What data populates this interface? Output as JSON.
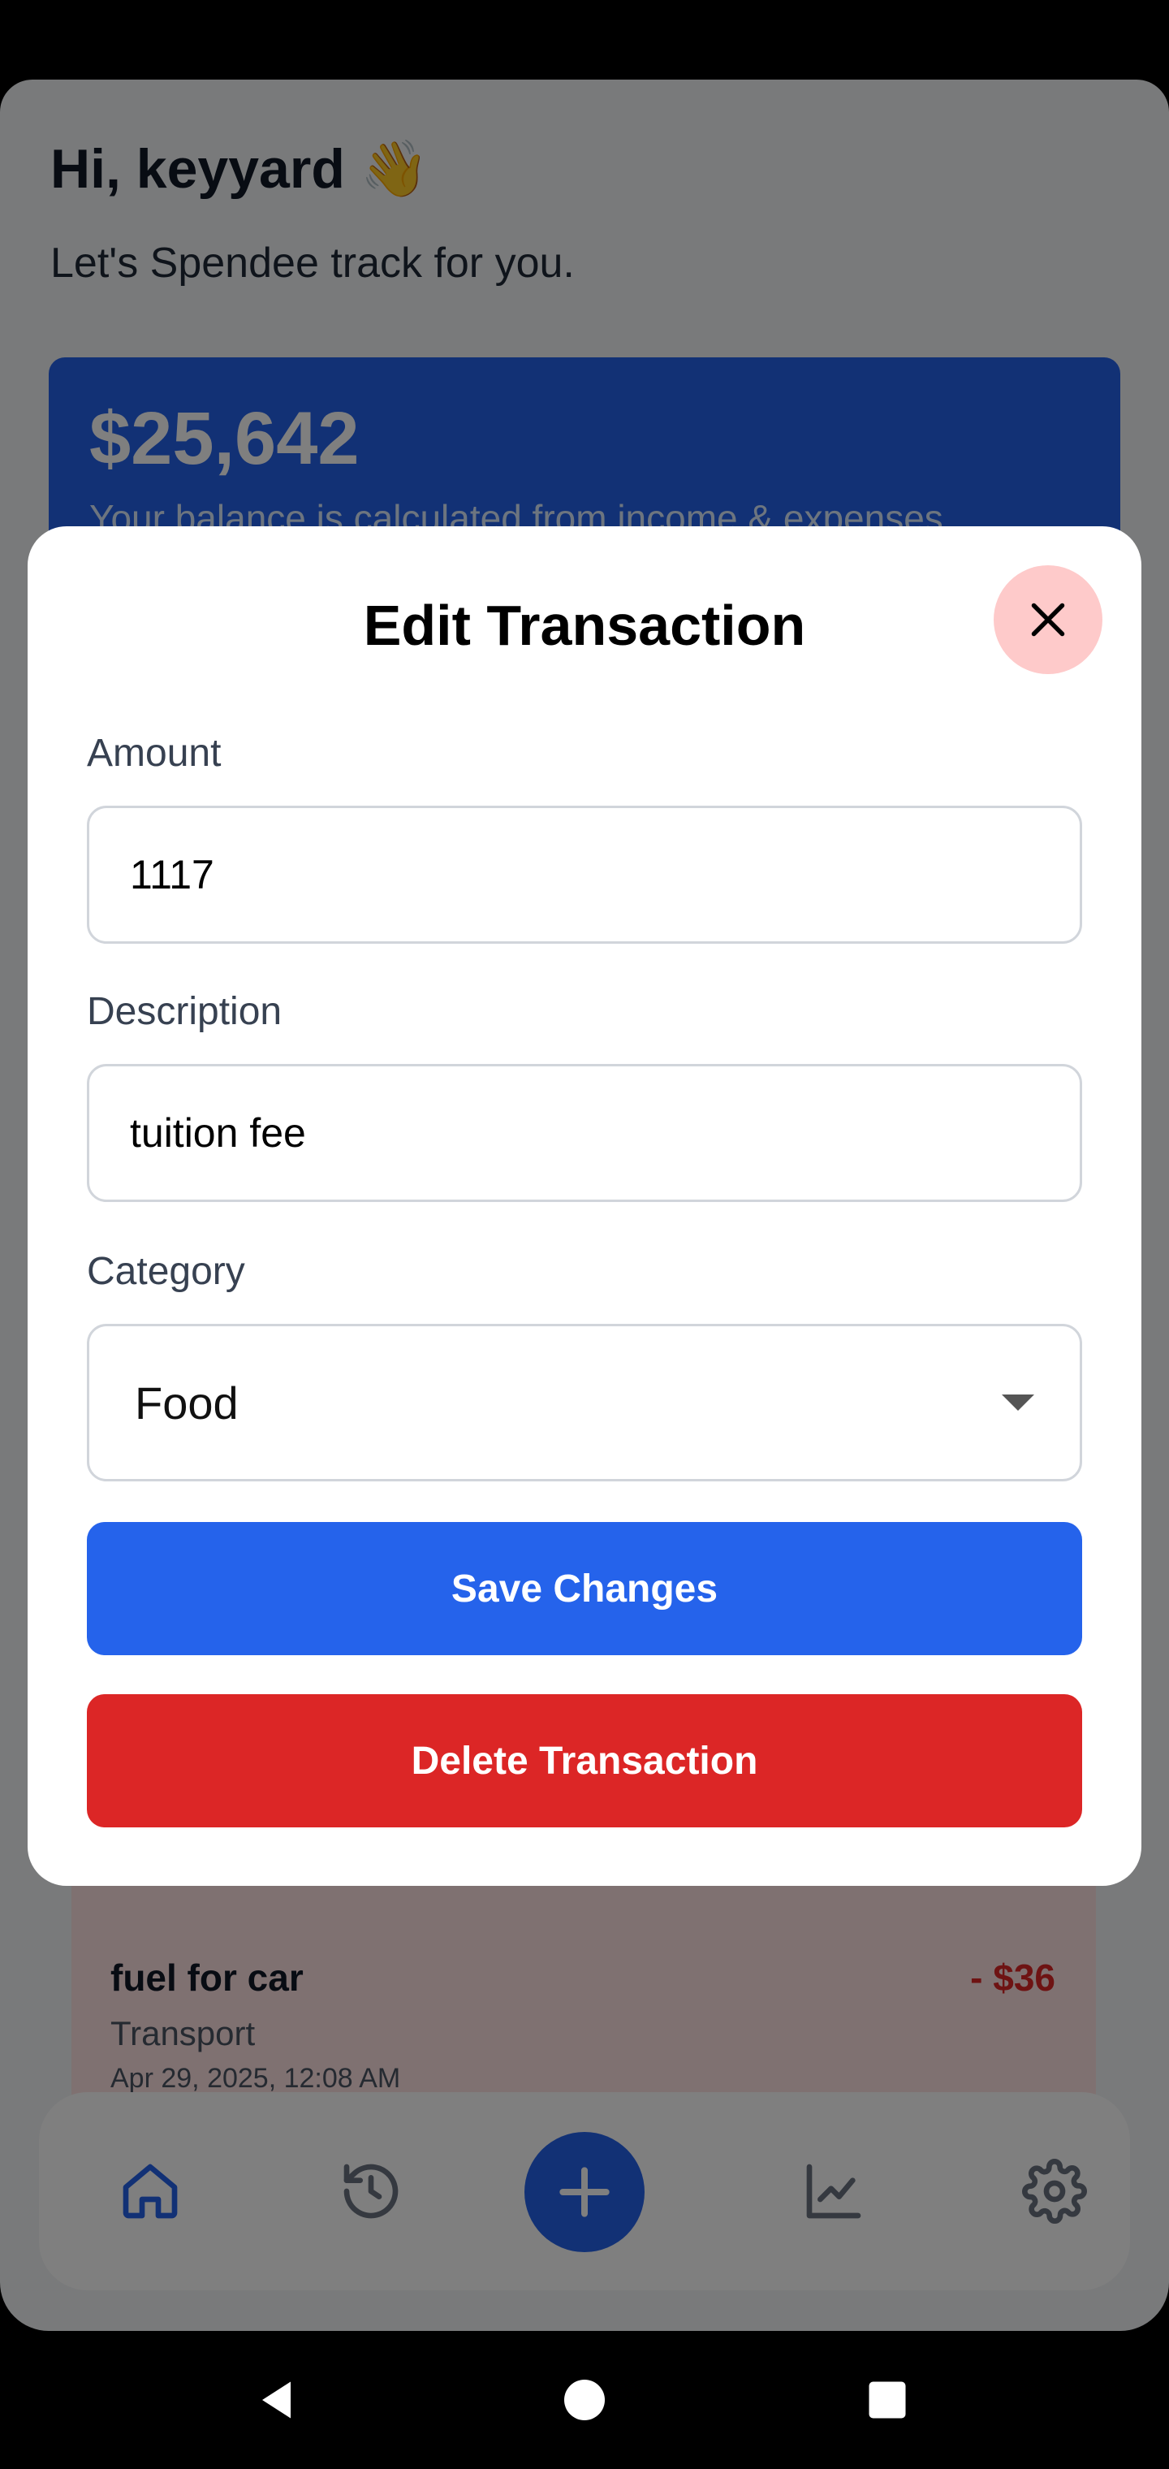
{
  "header": {
    "greeting": "Hi, keyyard 👋",
    "subtitle": "Let's Spendee track for you."
  },
  "balance": {
    "amount": "$25,642",
    "note": "Your balance is calculated from income & expenses"
  },
  "transaction": {
    "title": "fuel for car",
    "amount": "- $36",
    "category": "Transport",
    "date": "Apr 29, 2025, 12:08 AM"
  },
  "bottom_nav": {
    "items": [
      "home-icon",
      "history-icon",
      "add-icon",
      "chart-icon",
      "settings-icon"
    ]
  },
  "modal": {
    "title": "Edit Transaction",
    "amount_label": "Amount",
    "amount_value": "1117",
    "description_label": "Description",
    "description_value": "tuition fee",
    "category_label": "Category",
    "category_value": "Food",
    "save_label": "Save Changes",
    "delete_label": "Delete Transaction"
  },
  "colors": {
    "primary": "#2563eb",
    "danger": "#dc2626",
    "close_bg": "#fecaca"
  },
  "system_nav": [
    "back-icon",
    "home-circle-icon",
    "recents-icon"
  ]
}
